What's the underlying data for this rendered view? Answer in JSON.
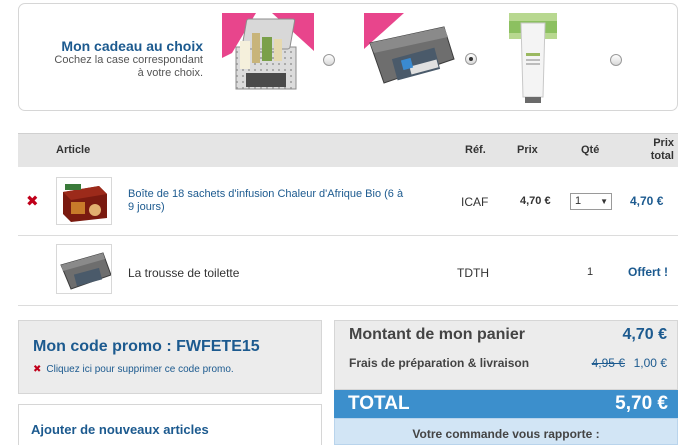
{
  "gift": {
    "title": "Mon cadeau au choix",
    "subtitle_line1": "Cochez la case correspondant",
    "subtitle_line2": "à votre choix.",
    "selected_index": 1
  },
  "cart": {
    "headers": {
      "article": "Article",
      "ref": "Réf.",
      "price": "Prix",
      "qty": "Qté",
      "total_line1": "Prix",
      "total_line2": "total"
    },
    "items": [
      {
        "name_line1": "Boîte de 18 sachets d'infusion Chaleur d'Afrique Bio (6 à",
        "name_line2": "9 jours)",
        "ref": "ICAF",
        "price": "4,70 €",
        "qty": "1",
        "total": "4,70 €"
      },
      {
        "name": "La trousse de toilette",
        "ref": "TDTH",
        "qty": "1",
        "total": "Offert !"
      }
    ]
  },
  "promo": {
    "title": "Mon code promo : FWFETE15",
    "remove_label": "Cliquez ici pour supprimer ce code promo."
  },
  "add_articles": {
    "title": "Ajouter de nouveaux articles"
  },
  "summary": {
    "subtotal_label": "Montant de mon panier",
    "subtotal_value": "4,70 €",
    "shipping_label": "Frais de préparation & livraison",
    "shipping_old": "4,95 €",
    "shipping_new": "1,00 €",
    "total_label": "TOTAL",
    "total_value": "5,70 €",
    "rewards_label": "Votre commande vous rapporte :"
  },
  "colors": {
    "brand_blue": "#1c5a8f",
    "total_bar": "#3c8fcc",
    "remove_red": "#c0001a"
  }
}
